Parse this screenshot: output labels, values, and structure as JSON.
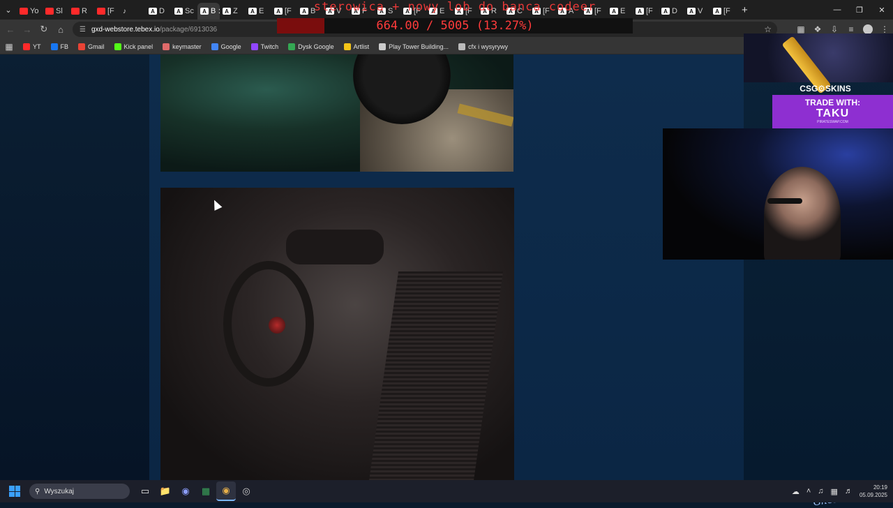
{
  "browser": {
    "tabs": [
      {
        "label": "Yo",
        "icon": "youtube-icon",
        "active": false
      },
      {
        "label": "Sl",
        "icon": "youtube-icon",
        "active": false
      },
      {
        "label": "R",
        "icon": "youtube-icon",
        "active": false
      },
      {
        "label": "[F",
        "icon": "youtube-icon",
        "active": false
      },
      {
        "label": "",
        "icon": "speaker-icon",
        "active": false
      },
      {
        "label": "D",
        "icon": "page-icon",
        "active": false
      },
      {
        "label": "Sc",
        "icon": "page-icon",
        "active": false
      },
      {
        "label": "B",
        "icon": "page-icon",
        "active": true
      },
      {
        "label": "Z",
        "icon": "page-icon",
        "active": false
      },
      {
        "label": "E",
        "icon": "page-icon",
        "active": false
      },
      {
        "label": "[F",
        "icon": "a-icon",
        "active": false
      },
      {
        "label": "B",
        "icon": "a-icon",
        "active": false
      },
      {
        "label": "V",
        "icon": "a-icon",
        "active": false
      },
      {
        "label": "F",
        "icon": "a-icon",
        "active": false
      },
      {
        "label": "S",
        "icon": "a-icon",
        "active": false
      },
      {
        "label": "[F",
        "icon": "a-icon",
        "active": false
      },
      {
        "label": "E",
        "icon": "a-icon",
        "active": false
      },
      {
        "label": "[F",
        "icon": "a-icon",
        "active": false
      },
      {
        "label": "R",
        "icon": "a-icon",
        "active": false
      },
      {
        "label": "C",
        "icon": "a-icon",
        "active": false
      },
      {
        "label": "[F",
        "icon": "a-icon",
        "active": false
      },
      {
        "label": "A",
        "icon": "a-icon",
        "active": false
      },
      {
        "label": "[F",
        "icon": "a-icon",
        "active": false
      },
      {
        "label": "E",
        "icon": "a-icon",
        "active": false
      },
      {
        "label": "[F",
        "icon": "a-icon",
        "active": false
      },
      {
        "label": "D",
        "icon": "a-icon",
        "active": false
      },
      {
        "label": "V",
        "icon": "a-icon",
        "active": false
      },
      {
        "label": "[F",
        "icon": "a-icon",
        "active": false
      }
    ],
    "new_tab": "+",
    "url_host": "gxd-webstore.tebex.io",
    "url_path": "/package/6913036"
  },
  "bookmarks": [
    {
      "label": "YT",
      "color": "#ff2a2a"
    },
    {
      "label": "FB",
      "color": "#1877f2"
    },
    {
      "label": "Gmail",
      "color": "#ea4335"
    },
    {
      "label": "Kick panel",
      "color": "#53fc18"
    },
    {
      "label": "keymaster",
      "color": "#e06a6a"
    },
    {
      "label": "Google",
      "color": "#4285f4"
    },
    {
      "label": "Twitch",
      "color": "#9146ff"
    },
    {
      "label": "Dysk Google",
      "color": "#34a853"
    },
    {
      "label": "Artlist",
      "color": "#f5c518"
    },
    {
      "label": "Play Tower Building...",
      "color": "#cccccc"
    },
    {
      "label": "cfx i wysyrywy",
      "color": "#bbbbbb"
    }
  ],
  "overlay": {
    "goal_title": "sterowica + nowy lob do banca codeer",
    "goal_amount": "664.00 / 5005 (13.27%)",
    "goal_fraction": 0.1327
  },
  "ad": {
    "brand": "CSG⚙SKINS",
    "line1": "TRADE WITH:",
    "line2": "TAKU",
    "line3": "PIRATESWAP.COM"
  },
  "signature": "GhostDevelopment",
  "taskbar": {
    "search_placeholder": "Wyszukaj",
    "time": "20:19",
    "date": "05.09.2025"
  },
  "colors": {
    "accent": "#7ab8ff",
    "page_bg": "#0b2440",
    "goal_red": "#ff3b3b"
  }
}
